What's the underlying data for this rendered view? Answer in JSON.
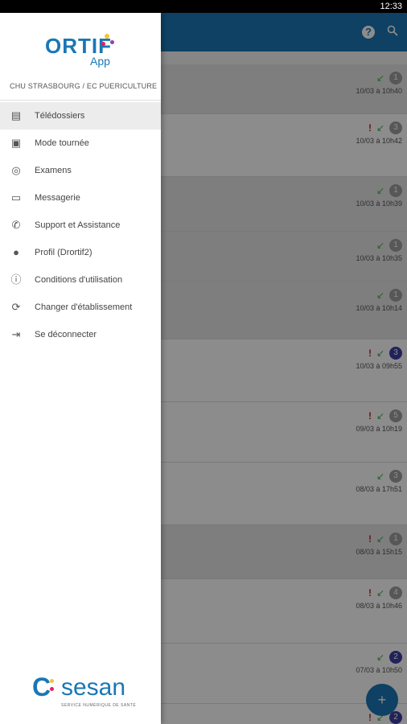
{
  "status_bar": {
    "time": "12:33"
  },
  "header": {
    "help_icon": "?",
    "search_icon": "search-icon"
  },
  "drawer": {
    "logo_main": "ORTIF",
    "logo_sub": "App",
    "establishment": "CHU STRASBOURG / EC PUERICULTURE",
    "menu": [
      {
        "label": "Télédossiers",
        "icon": "clipboard-icon",
        "glyph": "▤"
      },
      {
        "label": "Mode tournée",
        "icon": "photo-library-icon",
        "glyph": "▣"
      },
      {
        "label": "Examens",
        "icon": "fingerprint-icon",
        "glyph": "◎"
      },
      {
        "label": "Messagerie",
        "icon": "chat-icon",
        "glyph": "▭"
      },
      {
        "label": "Support et Assistance",
        "icon": "phone-icon",
        "glyph": "✆"
      },
      {
        "label": "Profil (Drortif2)",
        "icon": "account-icon",
        "glyph": "●"
      },
      {
        "label": "Conditions d'utilisation",
        "icon": "info-icon",
        "glyph": "ⓘ"
      },
      {
        "label": "Changer d'établissement",
        "icon": "sync-icon",
        "glyph": "⟳"
      },
      {
        "label": "Se déconnecter",
        "icon": "logout-icon",
        "glyph": "⇥"
      }
    ],
    "footer_logo": "sesan",
    "footer_sub": "SERVICE NUMÉRIQUE DE SANTÉ"
  },
  "list": [
    {
      "excl": false,
      "badge": "1",
      "badge_color": "grey",
      "date": "10/03 à 10h40"
    },
    {
      "excl": true,
      "badge": "3",
      "badge_color": "grey",
      "date": "10/03 à 10h42"
    },
    {
      "excl": false,
      "badge": "1",
      "badge_color": "grey",
      "date": "10/03 à 10h39"
    },
    {
      "excl": false,
      "badge": "1",
      "badge_color": "grey",
      "date": "10/03 à 10h35"
    },
    {
      "excl": false,
      "badge": "1",
      "badge_color": "grey",
      "date": "10/03 à 10h14"
    },
    {
      "excl": true,
      "badge": "3",
      "badge_color": "blue",
      "date": "10/03 à 09h55"
    },
    {
      "excl": true,
      "badge": "5",
      "badge_color": "grey",
      "date": "09/03 à 10h19"
    },
    {
      "excl": false,
      "badge": "3",
      "badge_color": "grey",
      "date": "08/03 à 17h51"
    },
    {
      "excl": true,
      "badge": "1",
      "badge_color": "grey",
      "date": "08/03 à 15h15"
    },
    {
      "excl": true,
      "badge": "4",
      "badge_color": "grey",
      "date": "08/03 à 10h46"
    },
    {
      "excl": false,
      "badge": "2",
      "badge_color": "blue",
      "date": "07/03 à 10h50"
    },
    {
      "excl": true,
      "badge": "2",
      "badge_color": "blue",
      "date": ""
    }
  ],
  "fab": {
    "icon": "add-folder-icon",
    "glyph": "+"
  }
}
